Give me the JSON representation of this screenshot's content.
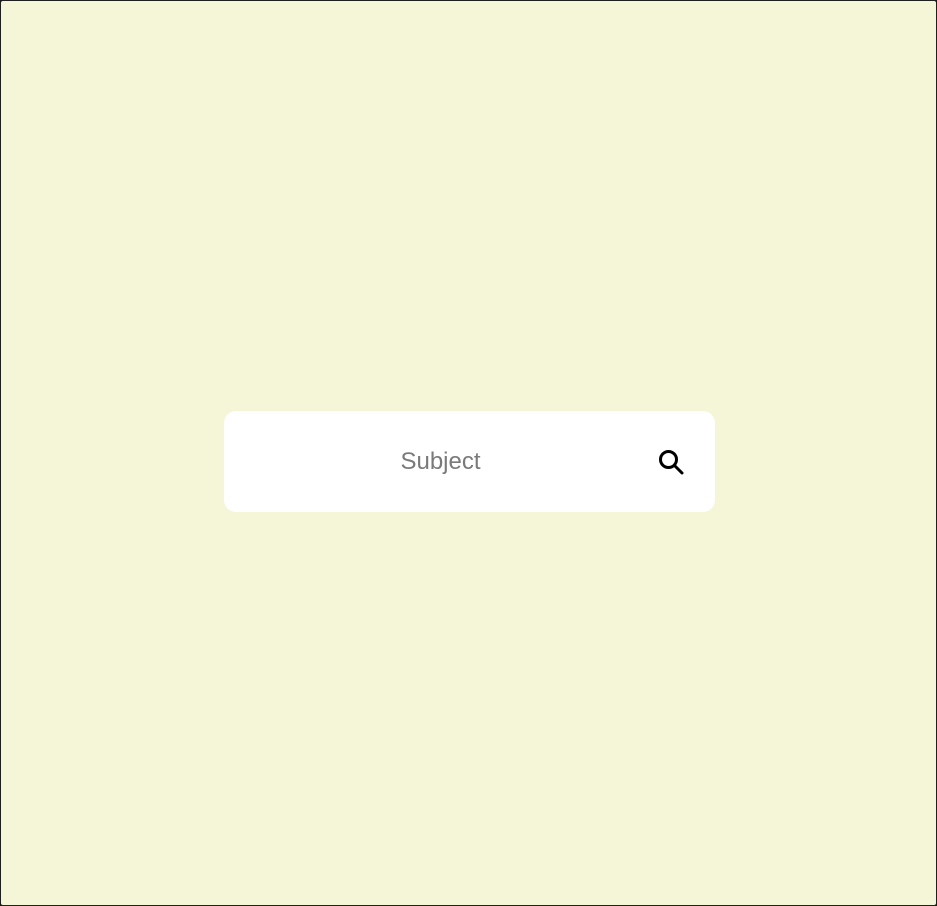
{
  "search": {
    "placeholder": "Subject",
    "value": "",
    "button_icon": "search-icon"
  },
  "colors": {
    "background": "#f5f5d8",
    "search_box": "#ffffff",
    "placeholder_text": "#7a7a7a",
    "icon": "#000000"
  }
}
